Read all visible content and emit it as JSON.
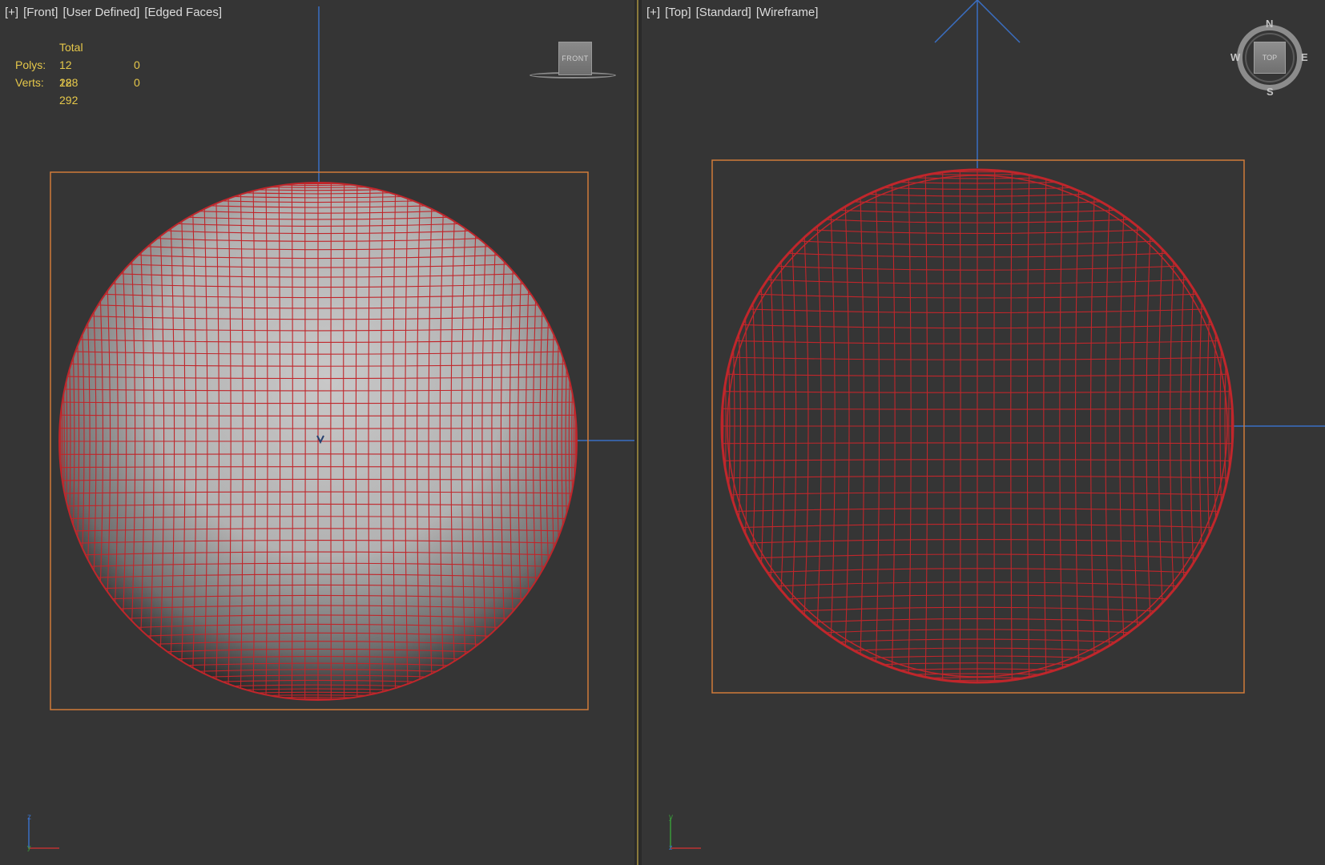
{
  "front_viewport": {
    "labels": [
      "[+]",
      "[Front]",
      "[User Defined]",
      "[Edged Faces]"
    ],
    "stats": {
      "header": "Total",
      "rows": [
        {
          "label": "Polys:",
          "total": "12 288",
          "selected": "0"
        },
        {
          "label": "Verts:",
          "total": "12 292",
          "selected": "0"
        }
      ]
    },
    "viewcube_label": "FRONT",
    "axis_label": "z"
  },
  "top_viewport": {
    "labels": [
      "[+]",
      "[Top]",
      "[Standard]",
      "[Wireframe]"
    ],
    "viewcube_label": "TOP",
    "compass": {
      "n": "N",
      "s": "S",
      "e": "E",
      "w": "W"
    }
  },
  "colors": {
    "viewport_bg": "#353535",
    "wire": "#c0262b",
    "bbox": "#d07b3a",
    "axis": "#3a6fc4",
    "stats_text": "#e6c84a"
  }
}
